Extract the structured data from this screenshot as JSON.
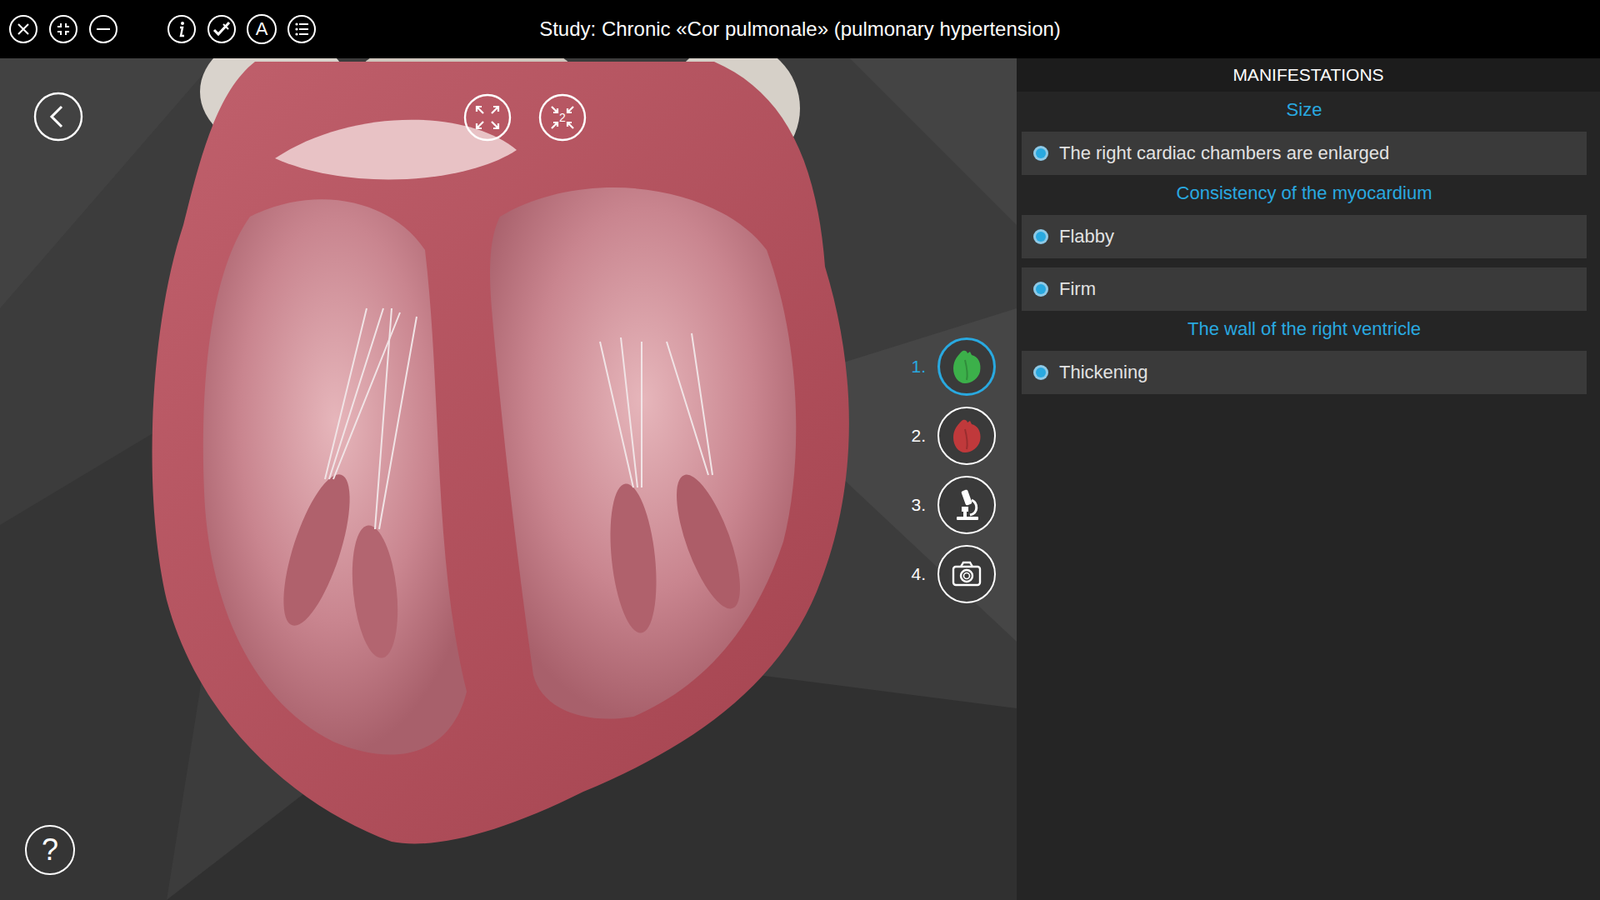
{
  "window": {
    "title": "Study: Chronic «Cor pulmonale» (pulmonary hypertension)"
  },
  "toolbar": {
    "font_button": "A"
  },
  "viewer": {
    "zoom_badge": "2",
    "help": "?",
    "steps": [
      {
        "number": "1.",
        "kind": "heart",
        "color": "#3cb04a",
        "selected": true
      },
      {
        "number": "2.",
        "kind": "heart",
        "color": "#c0393b",
        "selected": false
      },
      {
        "number": "3.",
        "kind": "microscope",
        "selected": false
      },
      {
        "number": "4.",
        "kind": "camera",
        "selected": false
      }
    ]
  },
  "panel": {
    "title": "MANIFESTATIONS",
    "sections": [
      {
        "heading": "Size",
        "items": [
          "The right cardiac chambers are enlarged"
        ]
      },
      {
        "heading": "Consistency of the myocardium",
        "items": [
          "Flabby",
          "Firm"
        ]
      },
      {
        "heading": "The wall of the right ventricle",
        "items": [
          "Thickening"
        ]
      }
    ]
  }
}
